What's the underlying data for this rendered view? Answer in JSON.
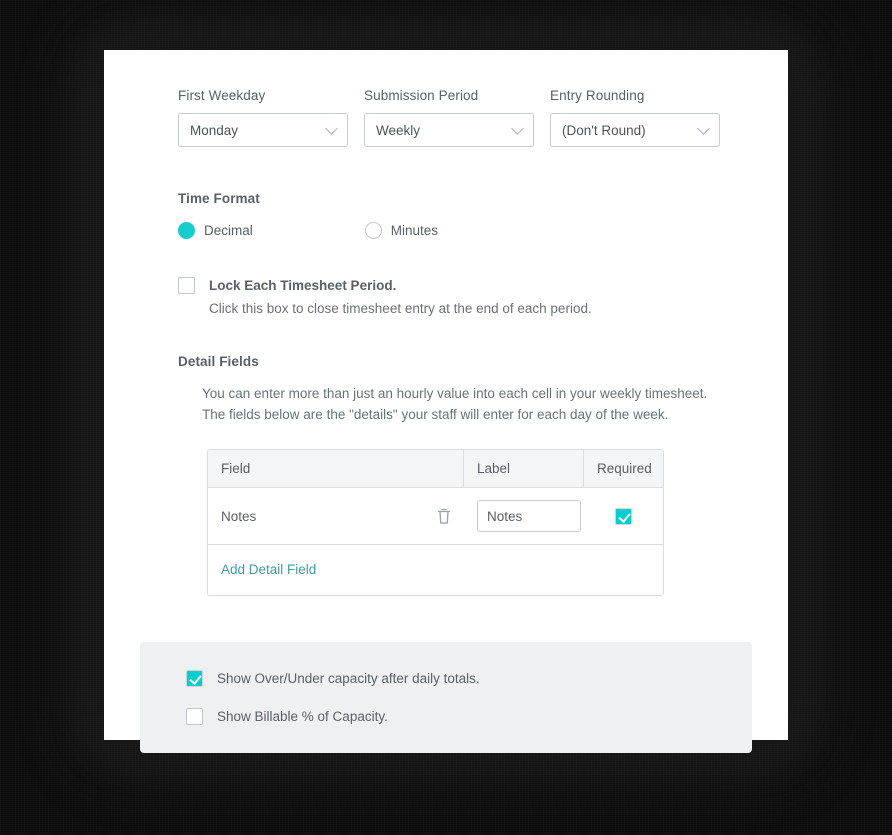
{
  "theme": {
    "accent": "#00cfcf",
    "radio_accent": "#16cdcd",
    "link": "#3f9c9c",
    "text": "#5a6068",
    "panel_bg": "#eff0f2",
    "card_bg": "#ffffff",
    "backdrop": "#0d0d0d"
  },
  "selects": [
    {
      "label": "First Weekday",
      "value": "Monday",
      "icon": "chevron-down-icon"
    },
    {
      "label": "Submission Period",
      "value": "Weekly",
      "icon": "chevron-down-icon"
    },
    {
      "label": "Entry Rounding",
      "value": "(Don't Round)",
      "icon": "chevron-down-icon"
    }
  ],
  "time_format": {
    "heading": "Time Format",
    "options": [
      {
        "label": "Decimal",
        "selected": true
      },
      {
        "label": "Minutes",
        "selected": false
      }
    ]
  },
  "lock_period": {
    "title": "Lock Each Timesheet Period.",
    "description": "Click this box to close timesheet entry at the end of each period.",
    "checked": false
  },
  "detail_fields": {
    "heading": "Detail Fields",
    "description_line1": "You can enter more than just an hourly value into each cell in your weekly timesheet.",
    "description_line2": "The fields below are the \"details\" your staff will enter for each day of the week.",
    "columns": [
      "Field",
      "Label",
      "Required"
    ],
    "rows": [
      {
        "field": "Notes",
        "label_value": "Notes",
        "label_placeholder": "Label",
        "required": true,
        "delete_icon": "trash-icon"
      }
    ],
    "add_link": "Add Detail Field"
  },
  "capacity_panel": {
    "options": [
      {
        "label": "Show Over/Under capacity after daily totals.",
        "checked": true
      },
      {
        "label": "Show Billable % of Capacity.",
        "checked": false
      }
    ]
  }
}
